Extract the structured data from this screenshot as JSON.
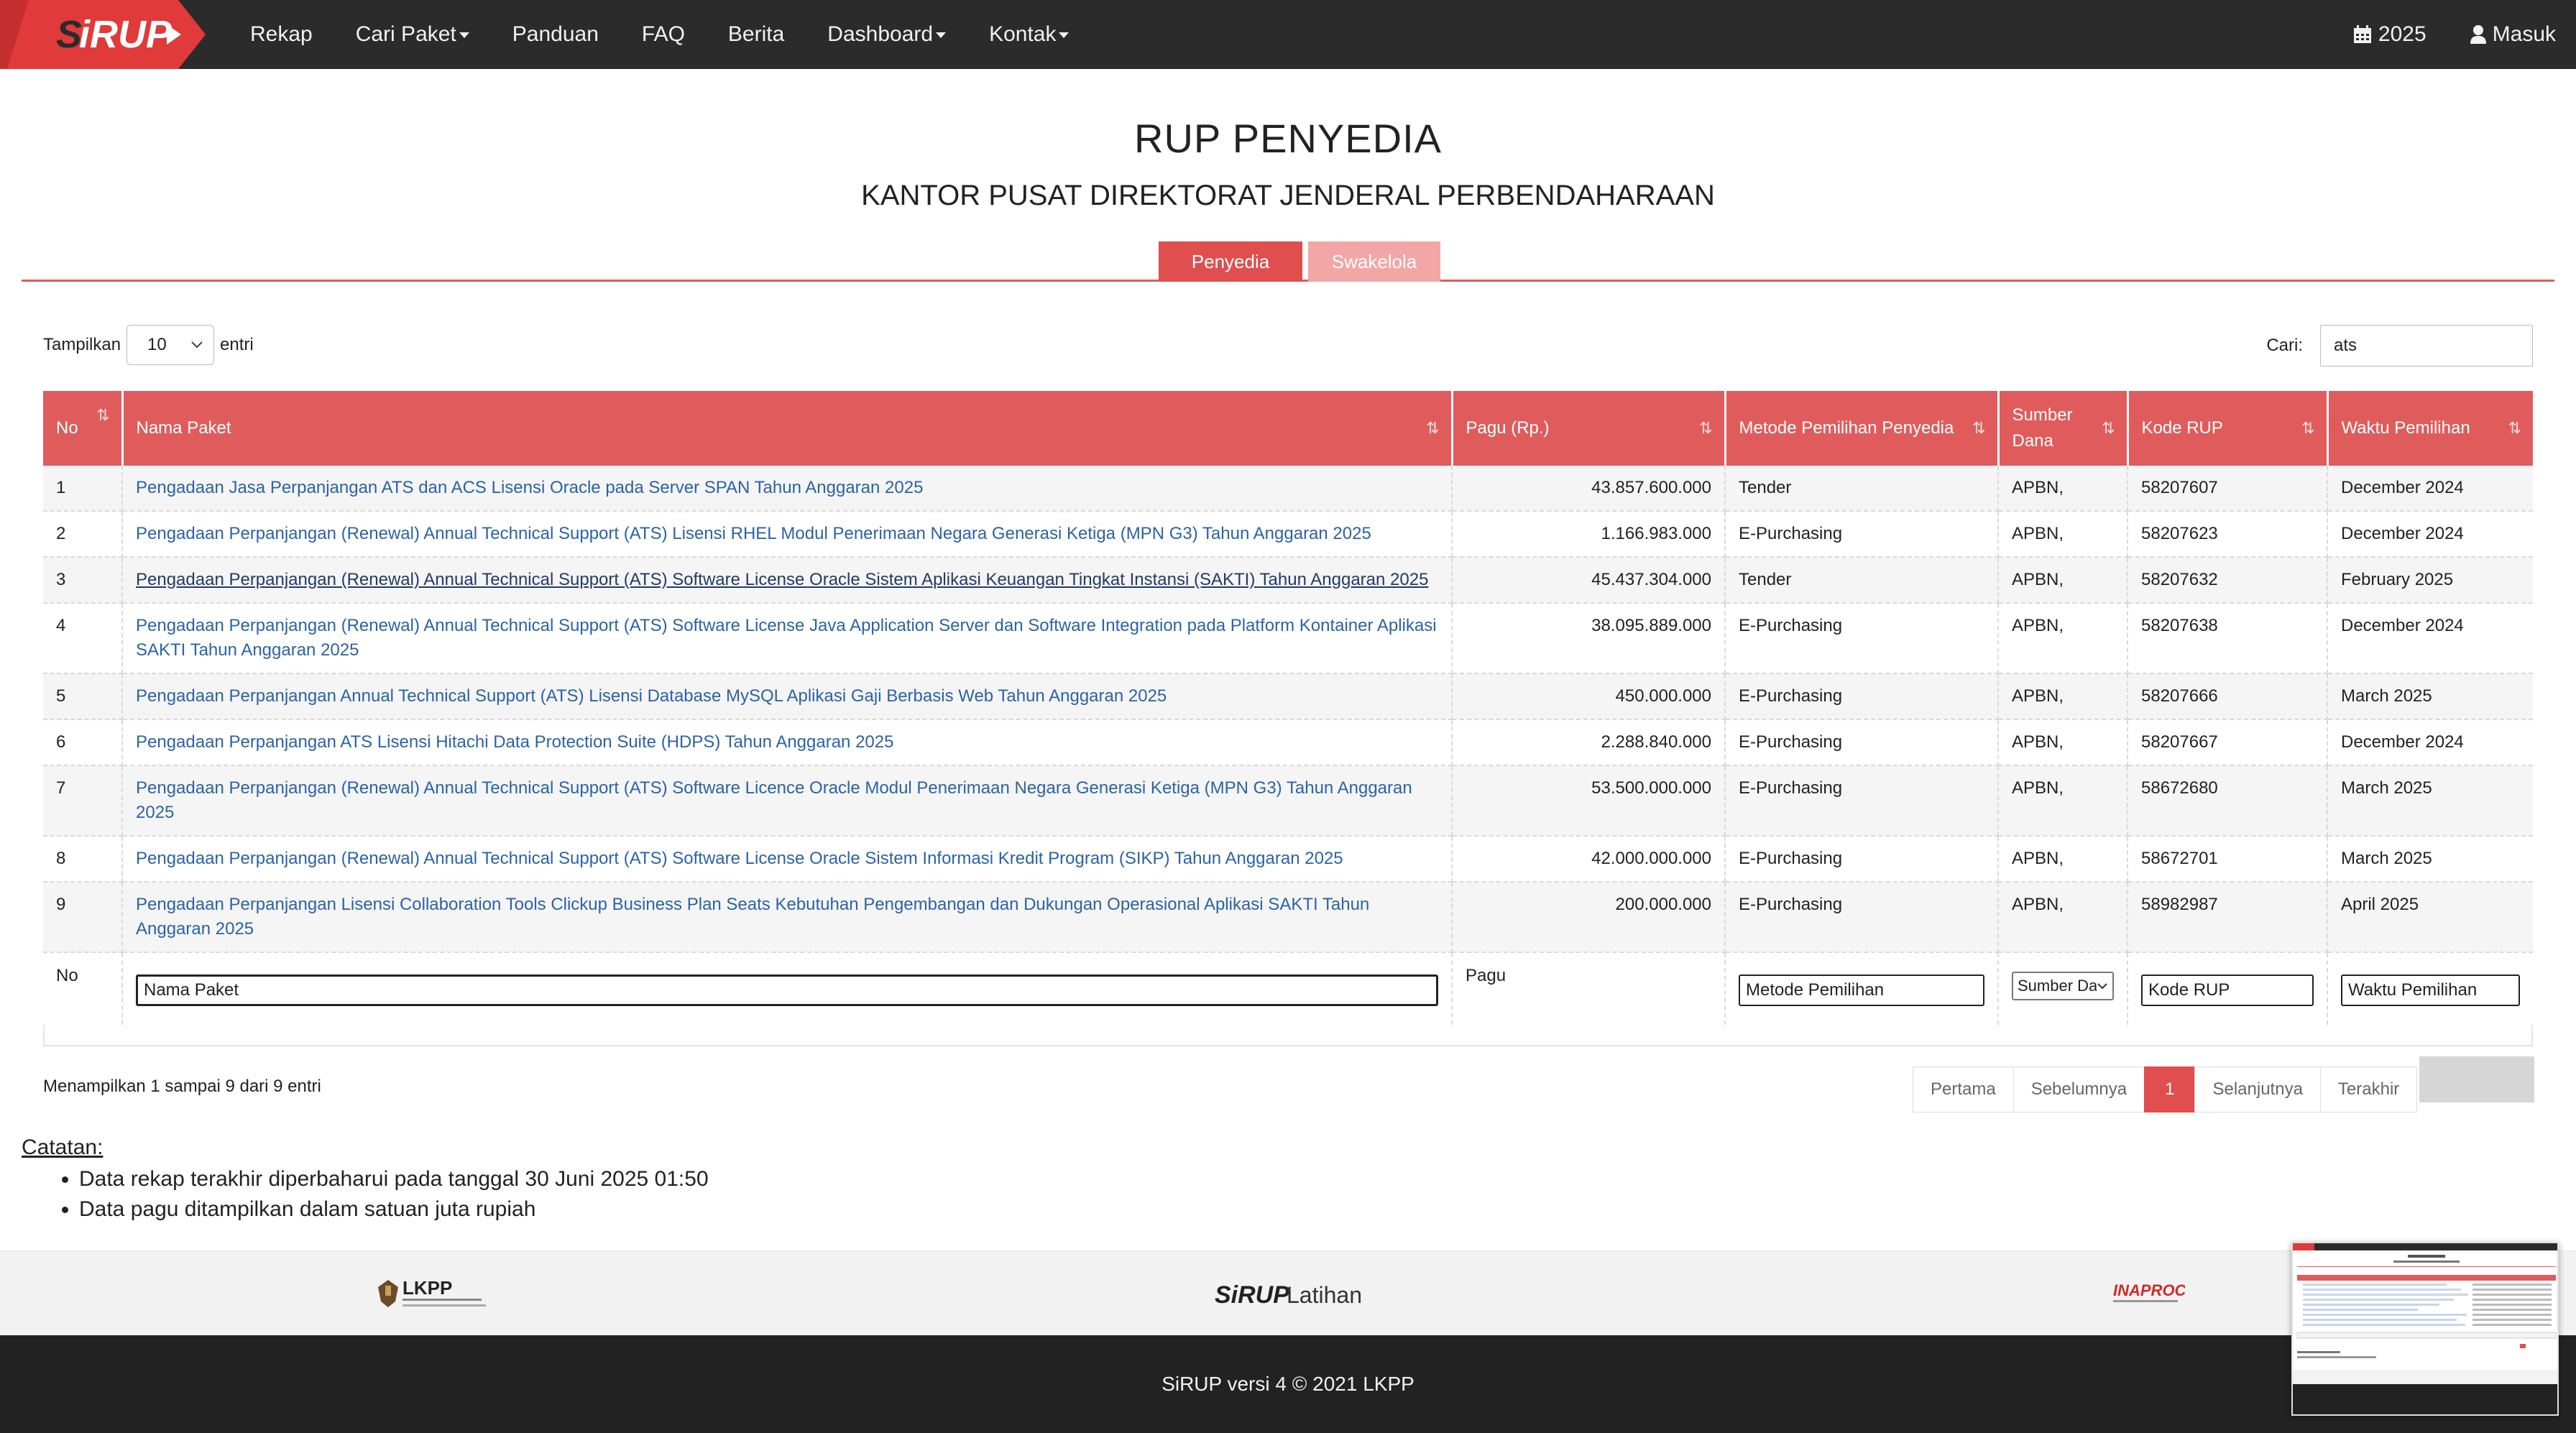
{
  "colors": {
    "navbar": "#2b2b2b",
    "accent": "#e05c5c",
    "tab_inactive": "#f2a6a6",
    "link": "#2b63a5",
    "footer": "#222222"
  },
  "brand": {
    "logo_text": "SiRUP"
  },
  "nav": {
    "items": [
      {
        "label": "Rekap",
        "dropdown": false
      },
      {
        "label": "Cari Paket",
        "dropdown": true
      },
      {
        "label": "Panduan",
        "dropdown": false
      },
      {
        "label": "FAQ",
        "dropdown": false
      },
      {
        "label": "Berita",
        "dropdown": false
      },
      {
        "label": "Dashboard",
        "dropdown": true
      },
      {
        "label": "Kontak",
        "dropdown": true
      }
    ],
    "year": {
      "label": "2025",
      "icon": "calendar-icon"
    },
    "login": {
      "label": "Masuk",
      "icon": "user-icon"
    }
  },
  "page": {
    "title": "RUP PENYEDIA",
    "subtitle": "KANTOR PUSAT DIREKTORAT JENDERAL PERBENDAHARAAN"
  },
  "tabs": [
    {
      "label": "Penyedia",
      "active": true
    },
    {
      "label": "Swakelola",
      "active": false
    }
  ],
  "controls": {
    "show_label": "Tampilkan",
    "show_value": "10",
    "entries_label": "entri",
    "search_label": "Cari:",
    "search_value": "ats"
  },
  "table": {
    "columns": [
      "No",
      "Nama Paket",
      "Pagu (Rp.)",
      "Metode Pemilihan Penyedia",
      "Sumber Dana",
      "Kode RUP",
      "Waktu Pemilihan"
    ],
    "rows": [
      {
        "no": "1",
        "nama": "Pengadaan Jasa Perpanjangan ATS dan ACS Lisensi Oracle pada Server SPAN Tahun Anggaran 2025",
        "pagu": "43.857.600.000",
        "metode": "Tender",
        "sumber": "APBN,",
        "kode": "58207607",
        "waktu": "December 2024"
      },
      {
        "no": "2",
        "nama": "Pengadaan Perpanjangan (Renewal) Annual Technical Support (ATS) Lisensi RHEL Modul Penerimaan Negara Generasi Ketiga (MPN G3) Tahun Anggaran 2025",
        "pagu": "1.166.983.000",
        "metode": "E-Purchasing",
        "sumber": "APBN,",
        "kode": "58207623",
        "waktu": "December 2024"
      },
      {
        "no": "3",
        "nama": "Pengadaan Perpanjangan (Renewal) Annual Technical Support (ATS) Software License Oracle Sistem Aplikasi Keuangan Tingkat Instansi (SAKTI) Tahun Anggaran 2025",
        "pagu": "45.437.304.000",
        "metode": "Tender",
        "sumber": "APBN,",
        "kode": "58207632",
        "waktu": "February 2025"
      },
      {
        "no": "4",
        "nama": "Pengadaan Perpanjangan (Renewal) Annual Technical Support (ATS) Software License Java Application Server dan Software Integration pada Platform Kontainer Aplikasi SAKTI Tahun Anggaran 2025",
        "pagu": "38.095.889.000",
        "metode": "E-Purchasing",
        "sumber": "APBN,",
        "kode": "58207638",
        "waktu": "December 2024"
      },
      {
        "no": "5",
        "nama": "Pengadaan Perpanjangan Annual Technical Support (ATS) Lisensi Database MySQL Aplikasi Gaji Berbasis Web Tahun Anggaran 2025",
        "pagu": "450.000.000",
        "metode": "E-Purchasing",
        "sumber": "APBN,",
        "kode": "58207666",
        "waktu": "March 2025"
      },
      {
        "no": "6",
        "nama": "Pengadaan Perpanjangan ATS Lisensi Hitachi Data Protection Suite (HDPS) Tahun Anggaran 2025",
        "pagu": "2.288.840.000",
        "metode": "E-Purchasing",
        "sumber": "APBN,",
        "kode": "58207667",
        "waktu": "December 2024"
      },
      {
        "no": "7",
        "nama": "Pengadaan Perpanjangan (Renewal) Annual Technical Support (ATS) Software Licence Oracle Modul Penerimaan Negara Generasi Ketiga (MPN G3) Tahun Anggaran 2025",
        "pagu": "53.500.000.000",
        "metode": "E-Purchasing",
        "sumber": "APBN,",
        "kode": "58672680",
        "waktu": "March 2025"
      },
      {
        "no": "8",
        "nama": "Pengadaan Perpanjangan (Renewal) Annual Technical Support (ATS) Software License Oracle Sistem Informasi Kredit Program (SIKP) Tahun Anggaran 2025",
        "pagu": "42.000.000.000",
        "metode": "E-Purchasing",
        "sumber": "APBN,",
        "kode": "58672701",
        "waktu": "March 2025"
      },
      {
        "no": "9",
        "nama": "Pengadaan Perpanjangan Lisensi Collaboration Tools Clickup Business Plan Seats Kebutuhan Pengembangan dan Dukungan Operasional Aplikasi SAKTI Tahun Anggaran 2025",
        "pagu": "200.000.000",
        "metode": "E-Purchasing",
        "sumber": "APBN,",
        "kode": "58982987",
        "waktu": "April 2025"
      }
    ],
    "footer": {
      "no": "No",
      "nama_placeholder": "Nama Paket",
      "pagu": "Pagu",
      "metode_placeholder": "Metode Pemilihan",
      "sumber_placeholder": "Sumber Dana",
      "kode_placeholder": "Kode RUP",
      "waktu_placeholder": "Waktu Pemilihan"
    }
  },
  "info": "Menampilkan 1 sampai 9 dari 9 entri",
  "pagination": {
    "first": "Pertama",
    "prev": "Sebelumnya",
    "current": "1",
    "next": "Selanjutnya",
    "last": "Terakhir"
  },
  "notes": {
    "title": "Catatan:",
    "items": [
      "Data rekap terakhir diperbaharui pada tanggal 30 Juni 2025 01:50",
      "Data pagu ditampilkan dalam satuan juta rupiah"
    ]
  },
  "footer": {
    "logos": {
      "lkpp": "LKPP",
      "sirup_latihan": "SiRUP",
      "latihan": "Latihan",
      "inaproc": "INAPROC"
    },
    "copyright": "SiRUP versi 4 © 2021 LKPP"
  }
}
